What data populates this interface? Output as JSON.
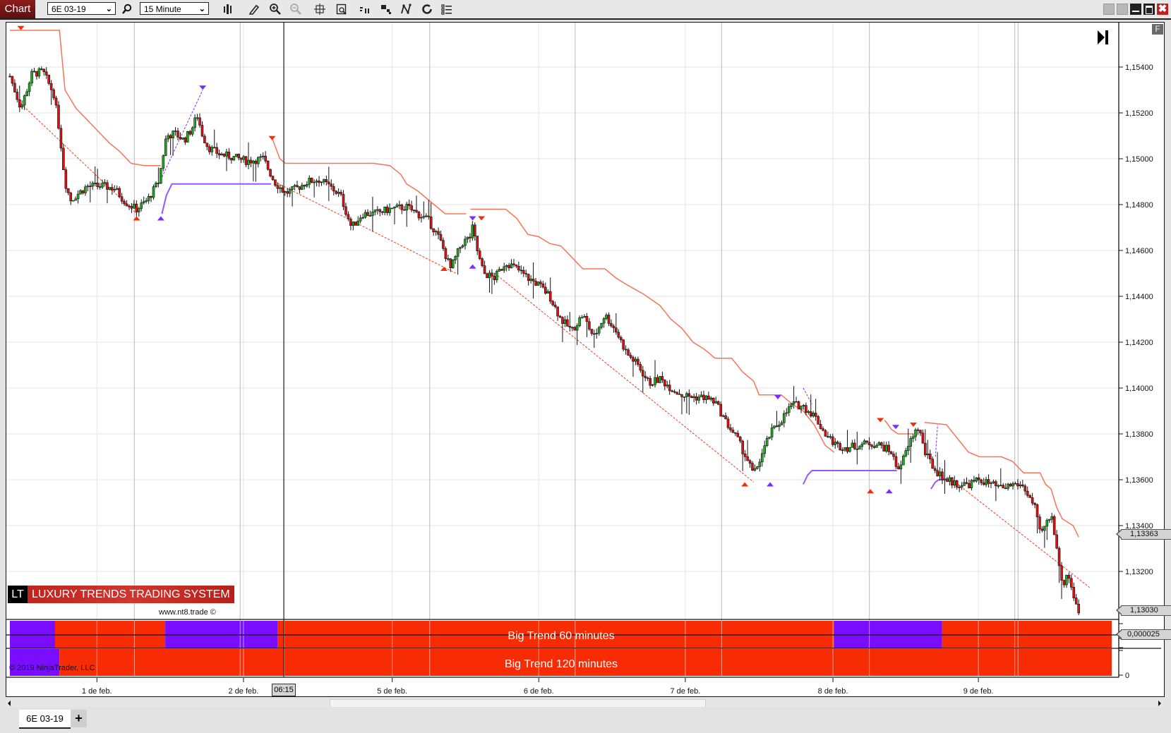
{
  "toolbar": {
    "chart_button": "Chart",
    "instrument": "6E 03-19",
    "timeframe": "15 Minute",
    "icons": [
      "search-icon",
      "bar-type-icon",
      "draw-pencil-icon",
      "zoom-in-icon",
      "zoom-out-icon",
      "crosshair-icon",
      "data-box-icon",
      "indicators-icon",
      "strategies-icon",
      "chart-trader-icon",
      "reload-icon",
      "properties-list-icon"
    ]
  },
  "window_buttons": [
    "link-button-1",
    "link-button-2",
    "minimize-button",
    "maximize-button",
    "close-button"
  ],
  "chart": {
    "f_button": "F",
    "branding_badge": "LT",
    "branding_title": "LUXURY TRENDS TRADING SYSTEM",
    "branding_url": "www.nt8.trade ©",
    "copyright": "© 2019 NinjaTrader, LLC",
    "current_price_label": "1,13030",
    "stop_price_label": "1,13363",
    "indicator_value_label": "0,000025",
    "indicator_zero_label": "0",
    "time_cursor_label": "06:15",
    "indicator_rows": [
      {
        "label": "Big Trend 60 minutes",
        "segments": [
          {
            "from": 0.0,
            "to": 0.041,
            "trend": "up"
          },
          {
            "from": 0.041,
            "to": 0.141,
            "trend": "down"
          },
          {
            "from": 0.141,
            "to": 0.243,
            "trend": "up"
          },
          {
            "from": 0.243,
            "to": 0.748,
            "trend": "down"
          },
          {
            "from": 0.748,
            "to": 0.846,
            "trend": "up"
          },
          {
            "from": 0.846,
            "to": 1.0,
            "trend": "down"
          }
        ]
      },
      {
        "label": "Big Trend 120 minutes",
        "segments": [
          {
            "from": 0.0,
            "to": 0.045,
            "trend": "up"
          },
          {
            "from": 0.045,
            "to": 1.0,
            "trend": "down"
          }
        ]
      }
    ],
    "colors": {
      "up": "#7a0cff",
      "down": "#f72c05",
      "bull_candle": "#22a822",
      "bear_candle": "#dd1111",
      "stop_line": "#f5755a",
      "trend_line": "#f03a1a",
      "support_line": "#9b55ff"
    }
  },
  "chart_data": {
    "type": "candlestick",
    "instrument": "6E 03-19",
    "interval": "15 Minute",
    "y_axis": {
      "ticks": [
        "1,15400",
        "1,15200",
        "1,15000",
        "1,14800",
        "1,14600",
        "1,14400",
        "1,14200",
        "1,14000",
        "1,13800",
        "1,13600",
        "1,13400",
        "1,13200"
      ],
      "range": [
        1.13,
        1.1558
      ]
    },
    "x_axis": {
      "ticks": [
        "1 de feb.",
        "2 de feb.",
        "5 de feb.",
        "6 de feb.",
        "7 de feb.",
        "8 de feb.",
        "9 de feb."
      ],
      "tick_fraction": [
        0.079,
        0.212,
        0.347,
        0.48,
        0.613,
        0.747,
        0.879
      ]
    },
    "session_separators": [
      0.113,
      0.209,
      0.249,
      0.381,
      0.513,
      0.646,
      0.78,
      0.912,
      0.915
    ],
    "close_path": [
      [
        0.0,
        1.1536
      ],
      [
        0.01,
        1.1522
      ],
      [
        0.02,
        1.1537
      ],
      [
        0.03,
        1.1538
      ],
      [
        0.04,
        1.1528
      ],
      [
        0.045,
        1.1512
      ],
      [
        0.05,
        1.149
      ],
      [
        0.055,
        1.1482
      ],
      [
        0.07,
        1.1488
      ],
      [
        0.085,
        1.1488
      ],
      [
        0.095,
        1.1487
      ],
      [
        0.105,
        1.1481
      ],
      [
        0.115,
        1.1478
      ],
      [
        0.125,
        1.1482
      ],
      [
        0.135,
        1.149
      ],
      [
        0.142,
        1.151
      ],
      [
        0.15,
        1.1511
      ],
      [
        0.158,
        1.1508
      ],
      [
        0.165,
        1.1513
      ],
      [
        0.17,
        1.1519
      ],
      [
        0.175,
        1.151
      ],
      [
        0.18,
        1.1505
      ],
      [
        0.19,
        1.1502
      ],
      [
        0.2,
        1.1501
      ],
      [
        0.215,
        1.1499
      ],
      [
        0.23,
        1.15
      ],
      [
        0.24,
        1.149
      ],
      [
        0.25,
        1.1485
      ],
      [
        0.26,
        1.1487
      ],
      [
        0.27,
        1.149
      ],
      [
        0.28,
        1.1491
      ],
      [
        0.29,
        1.1488
      ],
      [
        0.3,
        1.1484
      ],
      [
        0.31,
        1.147
      ],
      [
        0.32,
        1.1476
      ],
      [
        0.33,
        1.1476
      ],
      [
        0.345,
        1.1478
      ],
      [
        0.36,
        1.1479
      ],
      [
        0.37,
        1.1476
      ],
      [
        0.38,
        1.1473
      ],
      [
        0.39,
        1.1465
      ],
      [
        0.4,
        1.1452
      ],
      [
        0.41,
        1.1463
      ],
      [
        0.418,
        1.1466
      ],
      [
        0.42,
        1.147
      ],
      [
        0.425,
        1.1458
      ],
      [
        0.43,
        1.145
      ],
      [
        0.44,
        1.1448
      ],
      [
        0.45,
        1.1455
      ],
      [
        0.46,
        1.1452
      ],
      [
        0.47,
        1.1448
      ],
      [
        0.48,
        1.1445
      ],
      [
        0.49,
        1.144
      ],
      [
        0.5,
        1.143
      ],
      [
        0.51,
        1.1425
      ],
      [
        0.52,
        1.1432
      ],
      [
        0.53,
        1.1422
      ],
      [
        0.54,
        1.1432
      ],
      [
        0.55,
        1.1425
      ],
      [
        0.56,
        1.1415
      ],
      [
        0.57,
        1.141
      ],
      [
        0.58,
        1.1402
      ],
      [
        0.59,
        1.1404
      ],
      [
        0.6,
        1.14
      ],
      [
        0.61,
        1.1397
      ],
      [
        0.62,
        1.1396
      ],
      [
        0.63,
        1.1396
      ],
      [
        0.64,
        1.1394
      ],
      [
        0.65,
        1.1385
      ],
      [
        0.66,
        1.1378
      ],
      [
        0.67,
        1.1368
      ],
      [
        0.675,
        1.1362
      ],
      [
        0.68,
        1.1368
      ],
      [
        0.69,
        1.138
      ],
      [
        0.7,
        1.1386
      ],
      [
        0.71,
        1.1393
      ],
      [
        0.72,
        1.1392
      ],
      [
        0.73,
        1.1388
      ],
      [
        0.74,
        1.138
      ],
      [
        0.75,
        1.1375
      ],
      [
        0.76,
        1.1374
      ],
      [
        0.77,
        1.1375
      ],
      [
        0.78,
        1.1376
      ],
      [
        0.79,
        1.1375
      ],
      [
        0.8,
        1.1372
      ],
      [
        0.805,
        1.1365
      ],
      [
        0.81,
        1.1368
      ],
      [
        0.82,
        1.138
      ],
      [
        0.825,
        1.1383
      ],
      [
        0.83,
        1.1372
      ],
      [
        0.84,
        1.1364
      ],
      [
        0.85,
        1.136
      ],
      [
        0.86,
        1.1358
      ],
      [
        0.87,
        1.1358
      ],
      [
        0.88,
        1.136
      ],
      [
        0.89,
        1.1358
      ],
      [
        0.9,
        1.1356
      ],
      [
        0.91,
        1.1358
      ],
      [
        0.915,
        1.1358
      ],
      [
        0.92,
        1.1357
      ],
      [
        0.93,
        1.1348
      ],
      [
        0.935,
        1.1336
      ],
      [
        0.94,
        1.134
      ],
      [
        0.945,
        1.1345
      ],
      [
        0.95,
        1.1332
      ],
      [
        0.955,
        1.1313
      ],
      [
        0.96,
        1.132
      ],
      [
        0.965,
        1.131
      ],
      [
        0.97,
        1.1303
      ]
    ],
    "stop_line": [
      [
        0.0,
        1.1556
      ],
      [
        0.045,
        1.1556
      ],
      [
        0.05,
        1.153
      ],
      [
        0.06,
        1.1522
      ],
      [
        0.07,
        1.1517
      ],
      [
        0.08,
        1.1512
      ],
      [
        0.09,
        1.1507
      ],
      [
        0.1,
        1.1503
      ],
      [
        0.11,
        1.1498
      ],
      [
        0.122,
        1.1497
      ],
      [
        0.137,
        1.1497
      ],
      [
        0.137,
        null
      ],
      [
        0.238,
        1.1509
      ],
      [
        0.245,
        1.15
      ],
      [
        0.25,
        1.1498
      ],
      [
        0.33,
        1.1498
      ],
      [
        0.345,
        1.1497
      ],
      [
        0.355,
        1.1493
      ],
      [
        0.36,
        1.1489
      ],
      [
        0.37,
        1.1486
      ],
      [
        0.375,
        1.1484
      ],
      [
        0.385,
        1.148
      ],
      [
        0.395,
        1.1476
      ],
      [
        0.395,
        1.1476
      ],
      [
        0.414,
        1.1476
      ],
      [
        0.414,
        null
      ],
      [
        0.418,
        1.1478
      ],
      [
        0.45,
        1.1478
      ],
      [
        0.46,
        1.1474
      ],
      [
        0.47,
        1.1467
      ],
      [
        0.48,
        1.1466
      ],
      [
        0.49,
        1.1463
      ],
      [
        0.5,
        1.1462
      ],
      [
        0.51,
        1.1457
      ],
      [
        0.52,
        1.1452
      ],
      [
        0.54,
        1.1452
      ],
      [
        0.55,
        1.1448
      ],
      [
        0.56,
        1.1445
      ],
      [
        0.575,
        1.1441
      ],
      [
        0.59,
        1.1436
      ],
      [
        0.6,
        1.143
      ],
      [
        0.61,
        1.1426
      ],
      [
        0.62,
        1.142
      ],
      [
        0.63,
        1.1417
      ],
      [
        0.64,
        1.1413
      ],
      [
        0.655,
        1.1413
      ],
      [
        0.665,
        1.1407
      ],
      [
        0.675,
        1.1403
      ],
      [
        0.68,
        1.1397
      ],
      [
        0.7,
        1.1397
      ],
      [
        0.71,
        1.1393
      ],
      [
        0.72,
        1.139
      ],
      [
        0.73,
        1.1384
      ],
      [
        0.74,
        1.1375
      ],
      [
        0.748,
        1.1372
      ],
      [
        0.748,
        null
      ],
      [
        0.794,
        1.1386
      ],
      [
        0.8,
        1.1382
      ],
      [
        0.806,
        1.138
      ],
      [
        0.82,
        1.138
      ],
      [
        0.82,
        null
      ],
      [
        0.83,
        1.1385
      ],
      [
        0.85,
        1.1384
      ],
      [
        0.86,
        1.1378
      ],
      [
        0.87,
        1.1372
      ],
      [
        0.88,
        1.137
      ],
      [
        0.9,
        1.137
      ],
      [
        0.91,
        1.1368
      ],
      [
        0.92,
        1.1363
      ],
      [
        0.935,
        1.1363
      ],
      [
        0.94,
        1.1358
      ],
      [
        0.945,
        1.1356
      ],
      [
        0.95,
        1.1348
      ],
      [
        0.955,
        1.1343
      ],
      [
        0.965,
        1.134
      ],
      [
        0.97,
        1.1335
      ]
    ],
    "support_line": [
      [
        0.138,
        1.1476
      ],
      [
        0.142,
        1.1484
      ],
      [
        0.147,
        1.1489
      ],
      [
        0.237,
        1.1489
      ],
      [
        0.237,
        null
      ],
      [
        0.72,
        1.1358
      ],
      [
        0.724,
        1.1362
      ],
      [
        0.728,
        1.1364
      ],
      [
        0.805,
        1.1364
      ],
      [
        0.805,
        null
      ],
      [
        0.836,
        1.1356
      ],
      [
        0.84,
        1.1359
      ],
      [
        0.843,
        1.136
      ],
      [
        0.851,
        1.136
      ]
    ],
    "trend_lines": [
      {
        "color": "down",
        "from": [
          0.01,
          1.1524
        ],
        "to": [
          0.115,
          1.1476
        ]
      },
      {
        "color": "up",
        "from": [
          0.138,
          1.1492
        ],
        "to": [
          0.175,
          1.153
        ]
      },
      {
        "color": "down",
        "from": [
          0.24,
          1.149
        ],
        "to": [
          0.405,
          1.145
        ]
      },
      {
        "color": "down",
        "from": [
          0.44,
          1.145
        ],
        "to": [
          0.675,
          1.1359
        ]
      },
      {
        "color": "up",
        "from": [
          0.72,
          1.14
        ],
        "to": [
          0.728,
          1.1393
        ]
      },
      {
        "color": "up",
        "from": [
          0.84,
          1.137
        ],
        "to": [
          0.842,
          1.1384
        ]
      },
      {
        "color": "down",
        "from": [
          0.855,
          1.136
        ],
        "to": [
          0.98,
          1.1313
        ]
      }
    ],
    "markers": [
      {
        "x": 0.01,
        "price": 1.1557,
        "dir": "down",
        "color": "down"
      },
      {
        "x": 0.115,
        "price": 1.1474,
        "dir": "up",
        "color": "down"
      },
      {
        "x": 0.137,
        "price": 1.1474,
        "dir": "up",
        "color": "up"
      },
      {
        "x": 0.175,
        "price": 1.1531,
        "dir": "down",
        "color": "up"
      },
      {
        "x": 0.238,
        "price": 1.1509,
        "dir": "down",
        "color": "down"
      },
      {
        "x": 0.394,
        "price": 1.1452,
        "dir": "up",
        "color": "down"
      },
      {
        "x": 0.42,
        "price": 1.1453,
        "dir": "up",
        "color": "up"
      },
      {
        "x": 0.42,
        "price": 1.1474,
        "dir": "down",
        "color": "up"
      },
      {
        "x": 0.428,
        "price": 1.1474,
        "dir": "down",
        "color": "down"
      },
      {
        "x": 0.667,
        "price": 1.1358,
        "dir": "up",
        "color": "down"
      },
      {
        "x": 0.69,
        "price": 1.1358,
        "dir": "up",
        "color": "up"
      },
      {
        "x": 0.697,
        "price": 1.1396,
        "dir": "down",
        "color": "up"
      },
      {
        "x": 0.781,
        "price": 1.1355,
        "dir": "up",
        "color": "down"
      },
      {
        "x": 0.79,
        "price": 1.1386,
        "dir": "down",
        "color": "down"
      },
      {
        "x": 0.798,
        "price": 1.1355,
        "dir": "up",
        "color": "up"
      },
      {
        "x": 0.804,
        "price": 1.1383,
        "dir": "down",
        "color": "up"
      },
      {
        "x": 0.82,
        "price": 1.1384,
        "dir": "down",
        "color": "down"
      }
    ]
  }
}
